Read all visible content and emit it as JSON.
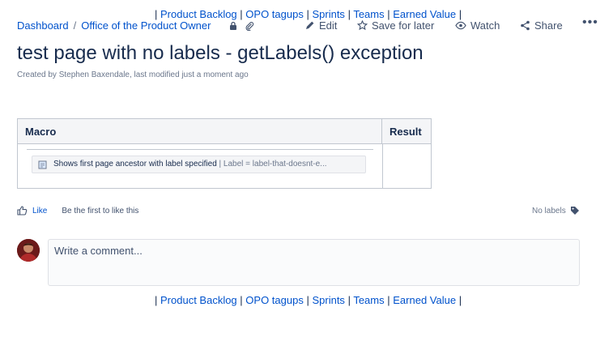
{
  "top_nav": {
    "links": [
      "Product Backlog",
      "OPO tagups",
      "Sprints",
      "Teams",
      "Earned Value"
    ]
  },
  "bottom_nav": {
    "links": [
      "Product Backlog",
      "OPO tagups",
      "Sprints",
      "Teams",
      "Earned Value"
    ]
  },
  "breadcrumb": {
    "items": [
      "Dashboard",
      "Office of the Product Owner"
    ],
    "icons": [
      "lock-icon",
      "attachment-icon"
    ]
  },
  "actions": {
    "edit": "Edit",
    "save_for_later": "Save for later",
    "watch": "Watch",
    "share": "Share",
    "more": "•••"
  },
  "page": {
    "title": "test page with no labels - getLabels() exception",
    "byline": "Created by Stephen Baxendale, last modified just a moment ago"
  },
  "table": {
    "headers": [
      "Macro",
      "Result"
    ],
    "macro": {
      "name": "Shows first page ancestor with label specified",
      "params": " | Label = label-that-doesnt-e..."
    }
  },
  "likes": {
    "like_label": "Like",
    "description": "Be the first to like this"
  },
  "labels": {
    "text": "No labels"
  },
  "comment": {
    "placeholder": "Write a comment..."
  },
  "colors": {
    "link": "#0052cc",
    "text": "#172b4d",
    "muted": "#6b778c",
    "border": "#c1c7d0",
    "header_bg": "#f4f5f7"
  }
}
